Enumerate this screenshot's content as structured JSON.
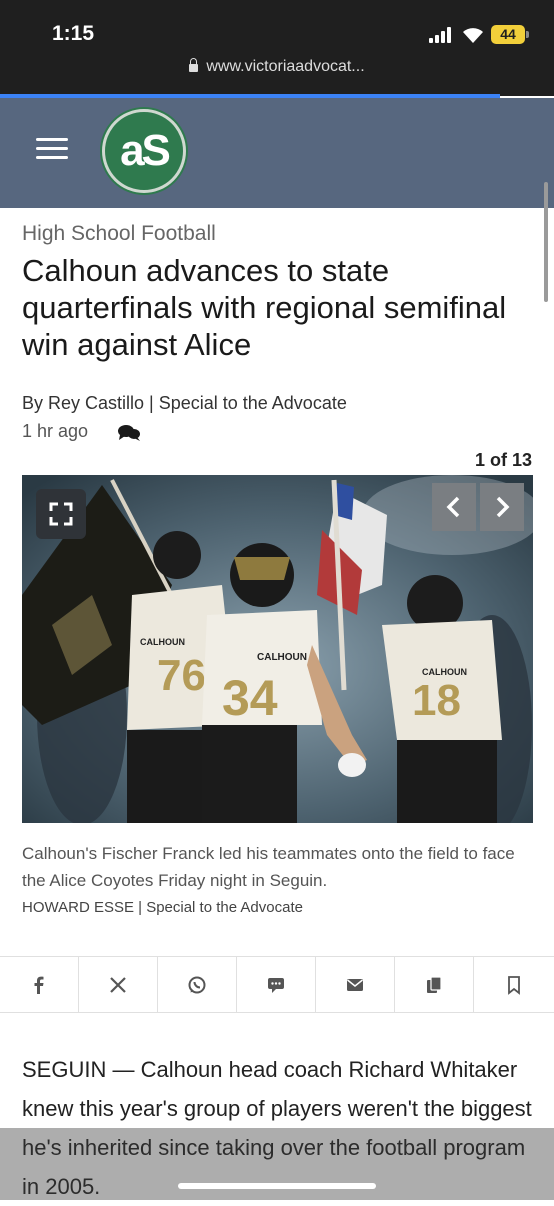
{
  "status_bar": {
    "time": "1:15",
    "battery": "44"
  },
  "browser": {
    "url": "www.victoriaadvocat..."
  },
  "site": {
    "logo_text": "aS"
  },
  "article": {
    "category": "High School Football",
    "headline": "Calhoun advances to state quarterfinals with regional semifinal win against Alice",
    "byline": "By Rey Castillo | Special to the Advocate",
    "time_ago": "1 hr ago",
    "gallery_counter": "1 of 13",
    "caption": "Calhoun's Fischer Franck led his teammates onto the field to face the Alice Coyotes Friday night in Seguin.",
    "photo_credit": "HOWARD ESSE | Special to the Advocate",
    "body": "SEGUIN — Calhoun head coach Richard Whitaker knew this year's group of players weren't the biggest he's inherited since taking over the football program in 2005."
  },
  "photo": {
    "jersey_numbers": [
      "34",
      "76",
      "18"
    ],
    "jersey_text": "CALHOUN"
  },
  "share_icons": [
    "facebook-icon",
    "x-icon",
    "whatsapp-icon",
    "sms-icon",
    "email-icon",
    "copy-icon",
    "bookmark-icon"
  ],
  "colors": {
    "header": "#57677f",
    "logo_green": "#2f7a4e",
    "battery": "#f2cf3a",
    "load_bar": "#3b82f6"
  }
}
